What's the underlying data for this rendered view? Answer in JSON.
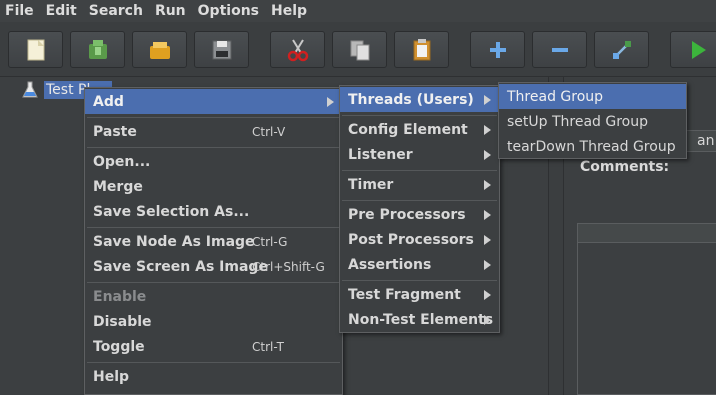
{
  "menubar": {
    "items": [
      "File",
      "Edit",
      "Search",
      "Run",
      "Options",
      "Help"
    ]
  },
  "toolbar": {
    "buttons": [
      "new-icon",
      "templates-icon",
      "open-icon",
      "save-icon",
      "cut-icon",
      "copy-icon",
      "paste-icon",
      "expand-icon",
      "collapse-icon",
      "toggle-icon",
      "start-icon"
    ]
  },
  "tree": {
    "root_label": "Test Pl"
  },
  "right_panel": {
    "partial_label": "an",
    "comments_label": "Comments:"
  },
  "context_menu": {
    "items": [
      {
        "label": "Add",
        "shortcut": ""
      },
      {
        "label": "Paste",
        "shortcut": "Ctrl-V"
      },
      {
        "label": "Open...",
        "shortcut": ""
      },
      {
        "label": "Merge",
        "shortcut": ""
      },
      {
        "label": "Save Selection As...",
        "shortcut": ""
      },
      {
        "label": "Save Node As Image",
        "shortcut": "Ctrl-G"
      },
      {
        "label": "Save Screen As Image",
        "shortcut": "Ctrl+Shift-G"
      },
      {
        "label": "Enable",
        "shortcut": ""
      },
      {
        "label": "Disable",
        "shortcut": ""
      },
      {
        "label": "Toggle",
        "shortcut": "Ctrl-T"
      },
      {
        "label": "Help",
        "shortcut": ""
      }
    ]
  },
  "add_submenu": {
    "items": [
      "Threads (Users)",
      "Config Element",
      "Listener",
      "Timer",
      "Pre Processors",
      "Post Processors",
      "Assertions",
      "Test Fragment",
      "Non-Test Elements"
    ]
  },
  "threads_submenu": {
    "items": [
      "Thread Group",
      "setUp Thread Group",
      "tearDown Thread Group"
    ]
  },
  "colors": {
    "selection": "#4b6eaf",
    "background": "#3c3f41"
  }
}
